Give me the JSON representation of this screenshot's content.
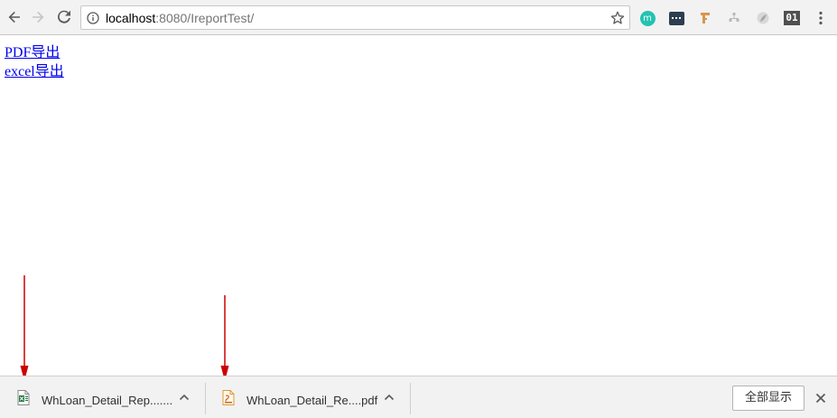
{
  "browser": {
    "url_host": "localhost",
    "url_rest": ":8080/IreportTest/"
  },
  "page": {
    "links": [
      {
        "label": "PDF导出"
      },
      {
        "label": "excel导出"
      }
    ]
  },
  "extensions": {
    "m_label": "m",
    "binary_label": "01"
  },
  "downloads": {
    "items": [
      {
        "name": "WhLoan_Detail_Rep.......",
        "icon": "excel-file-icon"
      },
      {
        "name": "WhLoan_Detail_Re....pdf",
        "icon": "pdf-file-icon"
      }
    ],
    "show_all_label": "全部显示"
  },
  "colors": {
    "link": "#0000ee",
    "annotation_arrow": "#cc0000",
    "extension_m": "#23c3b1"
  }
}
